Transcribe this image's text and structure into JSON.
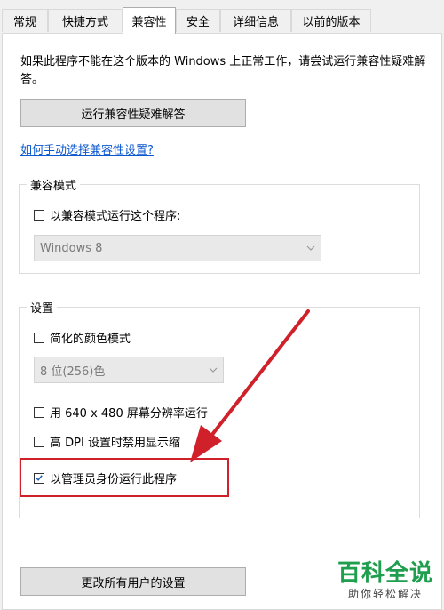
{
  "tabs": [
    {
      "label": "常规"
    },
    {
      "label": "快捷方式"
    },
    {
      "label": "兼容性"
    },
    {
      "label": "安全"
    },
    {
      "label": "详细信息"
    },
    {
      "label": "以前的版本"
    }
  ],
  "description": "如果此程序不能在这个版本的 Windows 上正常工作，请尝试运行兼容性疑难解答。",
  "troubleshoot_button": "运行兼容性疑难解答",
  "manual_link": "如何手动选择兼容性设置?",
  "compat_mode": {
    "title": "兼容模式",
    "checkbox_label": "以兼容模式运行这个程序:",
    "checked": false,
    "selected_os": "Windows 8"
  },
  "settings": {
    "title": "设置",
    "reduced_color": {
      "label": "简化的颜色模式",
      "checked": false
    },
    "color_select": "8 位(256)色",
    "res_640": {
      "label": "用 640 x 480 屏幕分辨率运行",
      "checked": false
    },
    "high_dpi": {
      "label": "高 DPI 设置时禁用显示缩",
      "checked": false
    },
    "run_as_admin": {
      "label": "以管理员身份运行此程序",
      "checked": true
    }
  },
  "all_users_button": "更改所有用户的设置",
  "watermark": {
    "title": "百科全说",
    "subtitle": "助你轻松解决"
  },
  "colors": {
    "accent": "#0b57d0",
    "highlight": "#d0202a",
    "watermark": "#1f9e4d"
  }
}
